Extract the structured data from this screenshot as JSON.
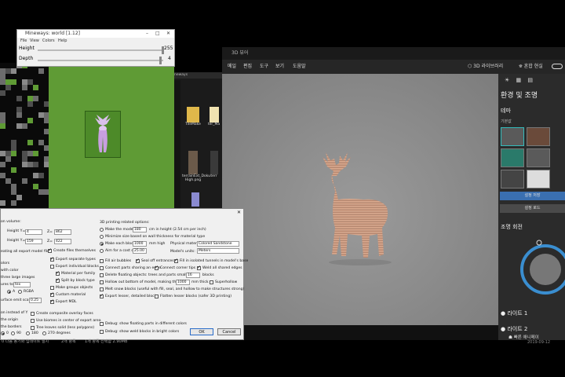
{
  "viewer": {
    "title": "3D 뷰어",
    "menu": [
      "메일",
      "편집",
      "도구",
      "보기",
      "도움말"
    ],
    "library_label": "3D 라이브러리",
    "mixed_reality_label": "혼합 현실",
    "panel_title": "환경 및 조명",
    "theme_label": "테마",
    "default_label": "기본값",
    "save_theme": "설정 저장",
    "load_theme": "설정 로드",
    "light_rotation": "조명 회전",
    "light1": "라이트 1",
    "light2": "라이트 2",
    "quick_anim": "빠른 애니메이",
    "status_left": "2개 항목",
    "status_mid": "1개 항목 선택함 2.90MB",
    "canvas_label": "deer model"
  },
  "mineways": {
    "title": "Mineways: world [1.12]",
    "menu": [
      "File",
      "View",
      "Colors",
      "Help"
    ],
    "height_label": "Height",
    "height_value": "255",
    "height_fraction": 1.0,
    "depth_label": "Depth",
    "depth_value": "4",
    "depth_fraction": 0.98
  },
  "explorer": {
    "title": "neways",
    "files": [
      {
        "name": "TileMake"
      },
      {
        "name": "ter_Ma"
      },
      {
        "name": "terrainExt_Doku High.png"
      },
      {
        "name": "terr"
      }
    ]
  },
  "dialog": {
    "left_col": [
      "on volume:",
      "Height Y=",
      "Height Y=",
      "eating all export model files",
      "olors",
      "with color",
      "three large images",
      "ures to",
      "A",
      "RGBA",
      "urface emit scale:",
      "on instead of Y",
      "the origin",
      "the borders",
      "0",
      "90",
      "180",
      "270 degrees"
    ],
    "height_y1": "4",
    "height_y2": "159",
    "z1": "862",
    "z2": "422",
    "z1_label": "Z=",
    "z2_label": "Z=",
    "tex_value": "tex",
    "emit_scale": "0.25",
    "middle_col": [
      "Create files themselves",
      "Export separate types",
      "Export individual blocks",
      "Material per family",
      "Split by block type",
      "Make groups objects",
      "Custom material",
      "Export MDL",
      "Create composite overlay faces",
      "Use biomes in center of export area",
      "Tree leaves solid (less polygons)"
    ],
    "right_col_title": "3D printing related options:",
    "make_model": "Make the model",
    "make_model_val": "180",
    "make_model_unit": "cm in height (2.54 cm per inch)",
    "minimize_size": "Minimize size based on wall thickness for material type",
    "make_each_block": "Make each block",
    "block_val": "1000",
    "block_unit": "mm high",
    "physical_material_label": "Physical material:",
    "physical_material": "Colored Sandstone",
    "aim_cost": "Aim for a cost of",
    "cost_val": "25.00",
    "model_units_label": "Model's units:",
    "model_units": "Meters",
    "fill_bubbles": "Fill air bubbles",
    "seal_entrances": "Seal off entrances",
    "fill_tunnels": "Fill in isolated tunnels in model's base",
    "connect_air": "Connect parts sharing an edge",
    "connect_corner": "Connect corner tips",
    "weld_edges": "Weld all shared edges",
    "delete_floating": "Delete floating objects: trees and parts smaller than",
    "floating_val": "16",
    "floating_unit": "blocks",
    "hollow": "Hollow out bottom of model, making the walls",
    "hollow_val": "1000",
    "hollow_unit": "mm thick",
    "superhollow": "Superhollow",
    "melt_snow": "Melt snow blocks (useful with fill, seal, and hollow to make structures strong)",
    "export_lesser": "Export lesser, detailed blocks",
    "flatten_lesser": "Flatten lesser blocks (safer 3D printing)",
    "debug_floating": "Debug: show floating parts in different colors",
    "debug_weld": "Debug: show weld blocks in bright colors",
    "ok": "OK",
    "cancel": "Cancel"
  },
  "taskbar": {
    "left_text": "0 다음 동기화 업데이트 설치",
    "right_text": "빠른 애니메이",
    "clock": "2019-09-12"
  }
}
